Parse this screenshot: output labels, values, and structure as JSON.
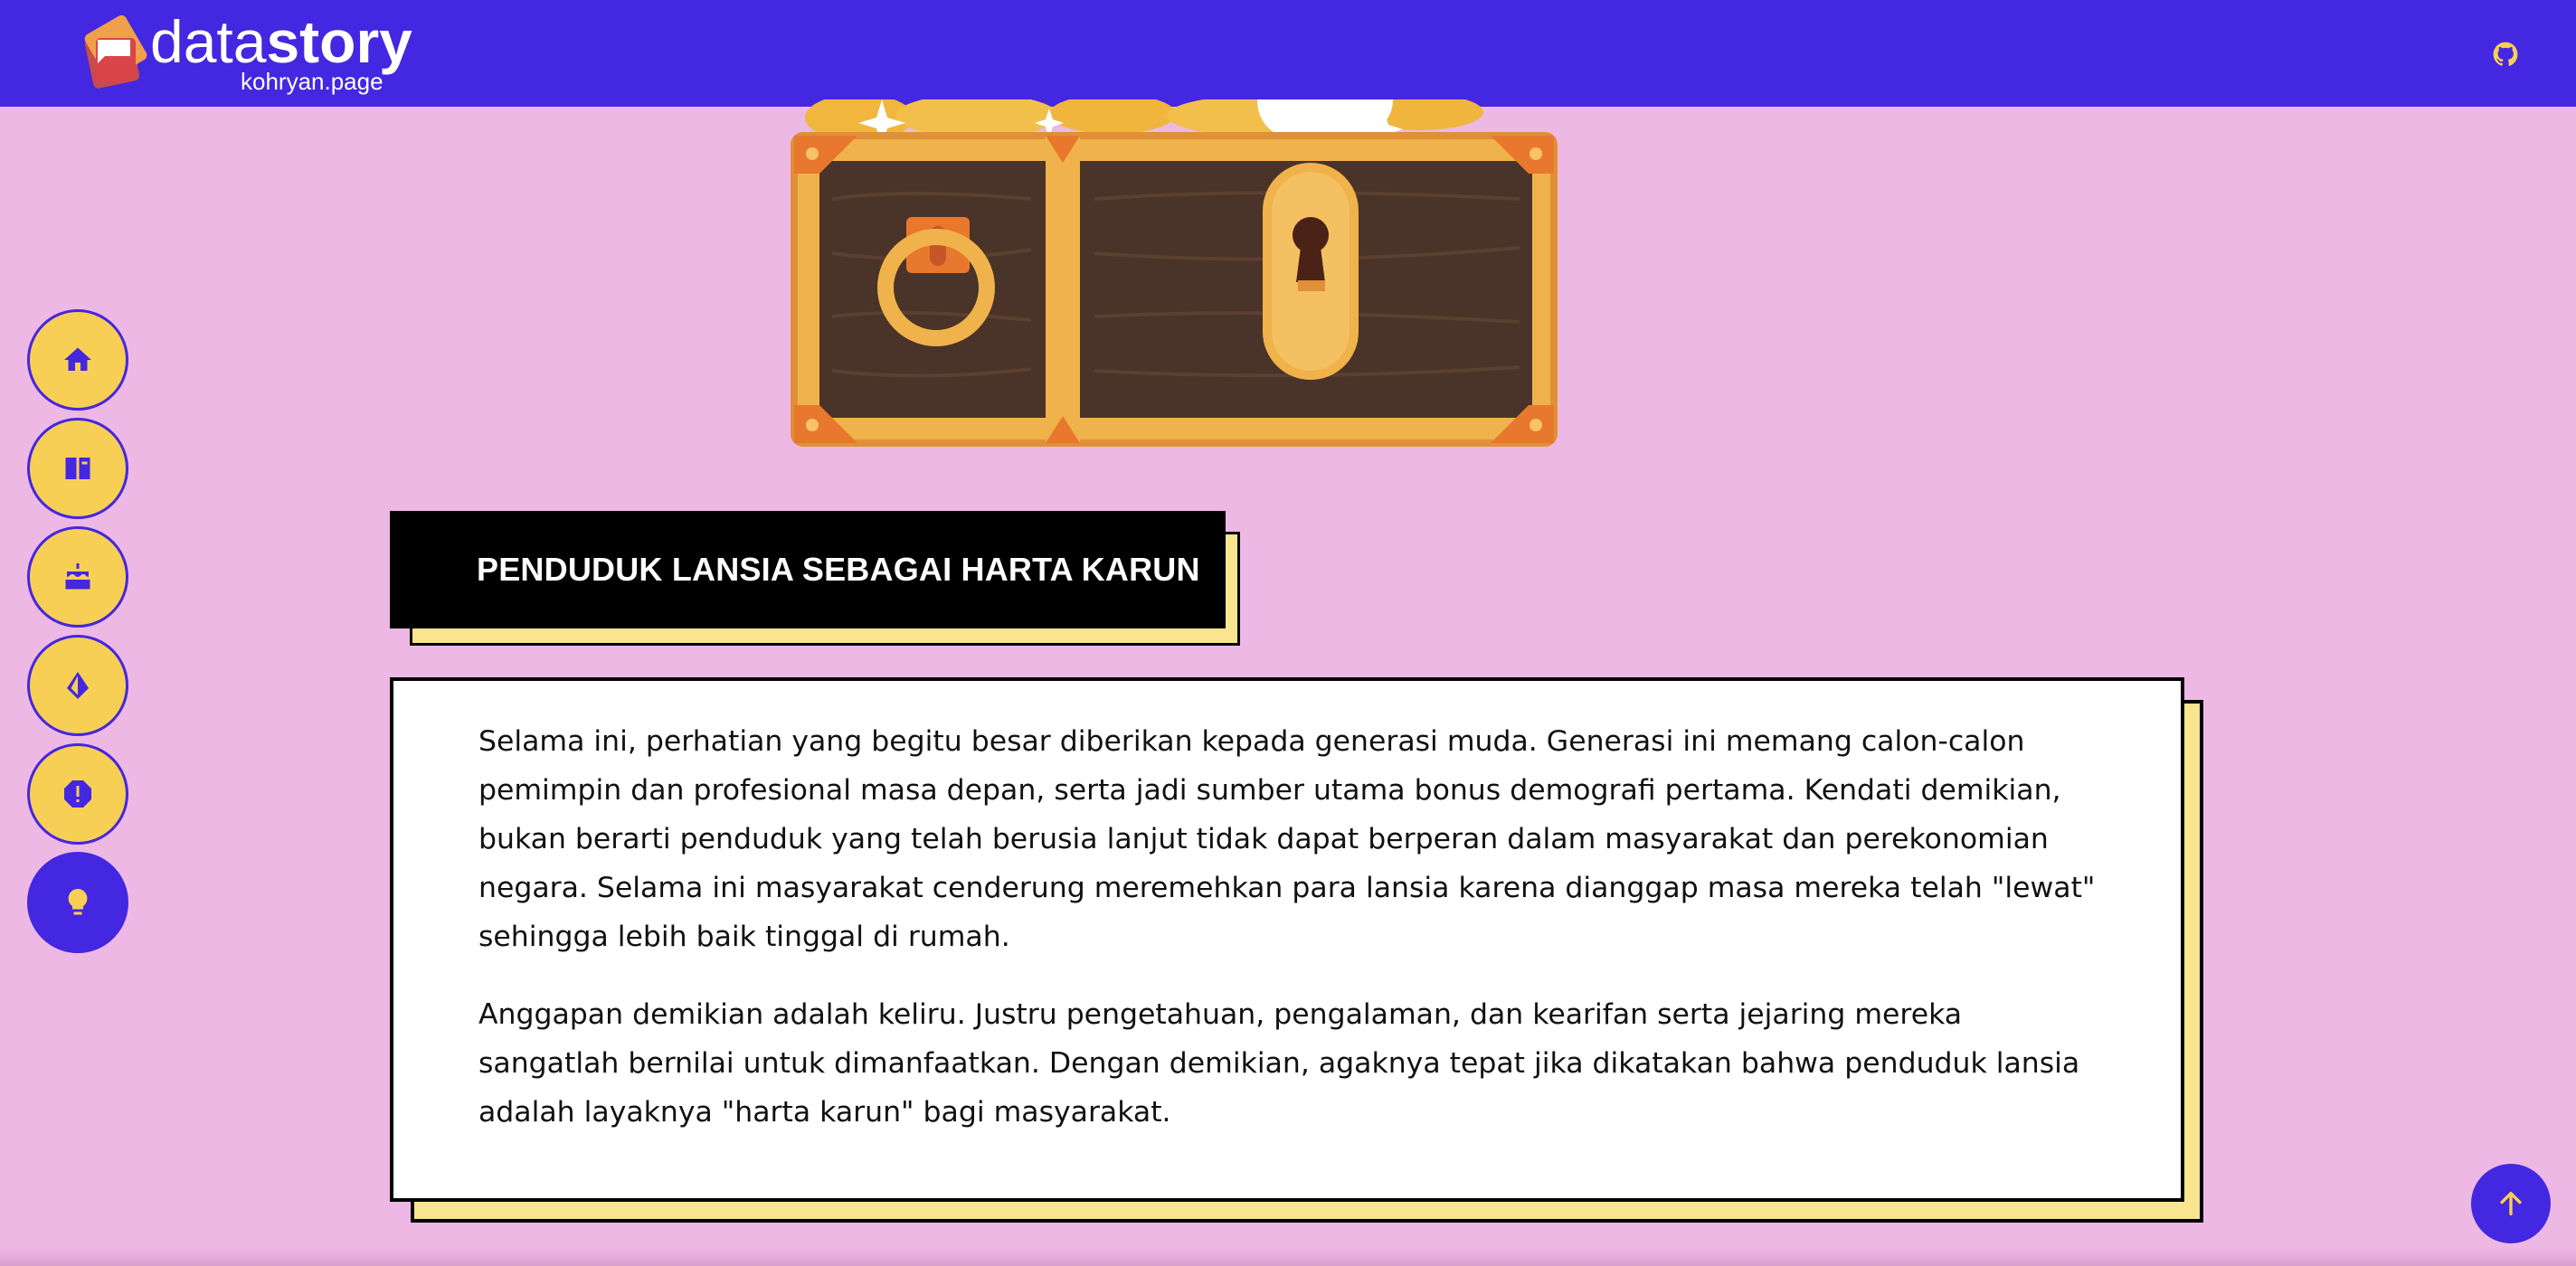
{
  "header": {
    "brand_light": "data",
    "brand_bold": "story",
    "brand_sub": "kohryan.page",
    "github_icon": "github-icon"
  },
  "sidebar": {
    "items": [
      {
        "name": "home",
        "icon": "home-icon"
      },
      {
        "name": "book",
        "icon": "book-icon"
      },
      {
        "name": "cake",
        "icon": "cake-icon"
      },
      {
        "name": "sail",
        "icon": "sail-icon"
      },
      {
        "name": "alert",
        "icon": "alert-icon"
      },
      {
        "name": "idea",
        "icon": "lightbulb-icon",
        "active": true
      }
    ]
  },
  "main": {
    "heading": "PENDUDUK LANSIA SEBAGAI HARTA KARUN",
    "paragraphs": [
      "Selama ini, perhatian yang begitu besar diberikan kepada generasi muda. Generasi ini memang calon-calon pemimpin dan profesional masa depan, serta jadi sumber utama bonus demografi pertama. Kendati demikian, bukan berarti penduduk yang telah berusia lanjut tidak dapat berperan dalam masyarakat dan perekonomian negara. Selama ini masyarakat cenderung meremehkan para lansia karena dianggap masa mereka telah \"lewat\" sehingga lebih baik tinggal di rumah.",
      "Anggapan demikian adalah keliru. Justru pengetahuan, pengalaman, dan kearifan serta jejaring mereka sangatlah bernilai untuk dimanfaatkan. Dengan demikian, agaknya tepat jika dikatakan bahwa penduduk lansia adalah layaknya \"harta karun\" bagi masyarakat."
    ]
  },
  "scroll_top_icon": "arrow-up-icon",
  "colors": {
    "header_bg": "#4427e0",
    "page_bg": "#eeb8e4",
    "nav_button": "#f8cf55",
    "card_shadow": "#f9e58f"
  }
}
